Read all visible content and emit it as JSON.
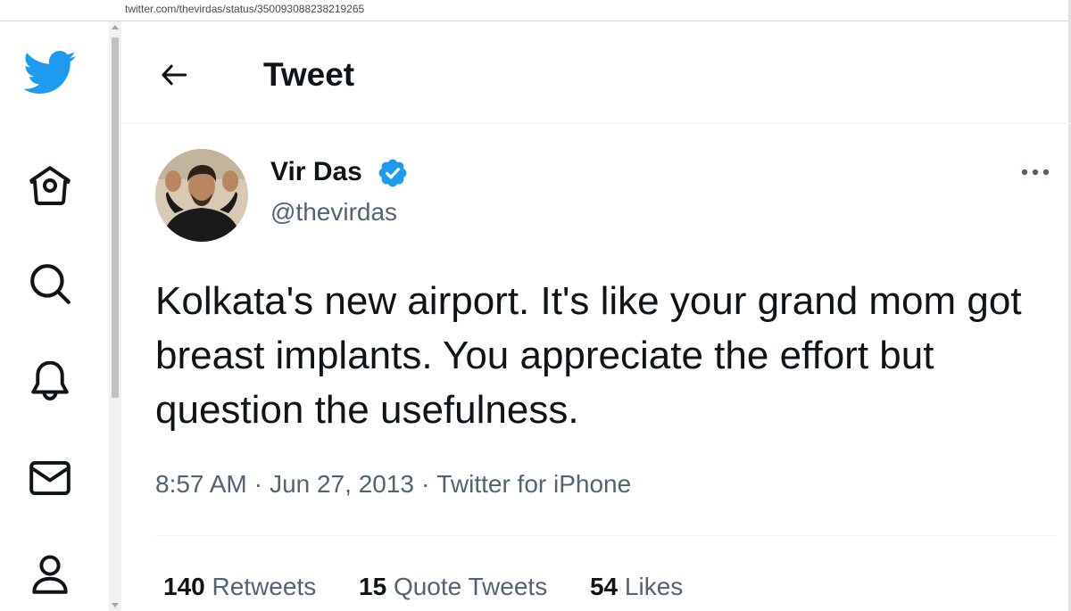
{
  "browser": {
    "url": "twitter.com/thevirdas/status/350093088238219265"
  },
  "sidebar": {
    "items": [
      {
        "icon": "twitter-bird-icon"
      },
      {
        "icon": "home-icon"
      },
      {
        "icon": "search-icon"
      },
      {
        "icon": "bell-icon"
      },
      {
        "icon": "mail-icon"
      },
      {
        "icon": "profile-icon"
      }
    ]
  },
  "header": {
    "title": "Tweet",
    "back_icon": "back-arrow-icon"
  },
  "tweet": {
    "author": {
      "name": "Vir Das",
      "handle": "@thevirdas",
      "verified": true
    },
    "text": "Kolkata's new airport. It's like your grand mom got breast implants. You appreciate the effort but question the usefulness.",
    "time": "8:57 AM",
    "date": "Jun 27, 2013",
    "source": "Twitter for iPhone",
    "separator": "·",
    "stats": {
      "retweets": {
        "count": "140",
        "label": "Retweets"
      },
      "quotes": {
        "count": "15",
        "label": "Quote Tweets"
      },
      "likes": {
        "count": "54",
        "label": "Likes"
      }
    }
  },
  "colors": {
    "brand": "#1d9bf0",
    "text": "#0f1419",
    "secondary": "#536471"
  }
}
